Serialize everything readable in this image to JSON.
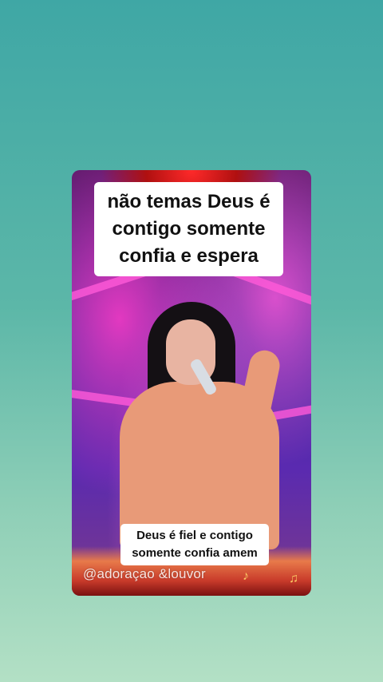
{
  "video": {
    "caption_top": "não temas Deus é contigo somente confia e espera",
    "caption_bottom_line1": "Deus é fiel e contigo",
    "caption_bottom_line2": "somente confia amem",
    "watermark": "@adoraçao &louvor"
  },
  "colors": {
    "background_top": "#3fa7a5",
    "background_bottom": "#b3e0c5",
    "stage_pink": "#ff5ad8",
    "stage_purple": "#3a2a9a"
  },
  "icons": {
    "note_left": "♪",
    "note_right": "♫"
  }
}
